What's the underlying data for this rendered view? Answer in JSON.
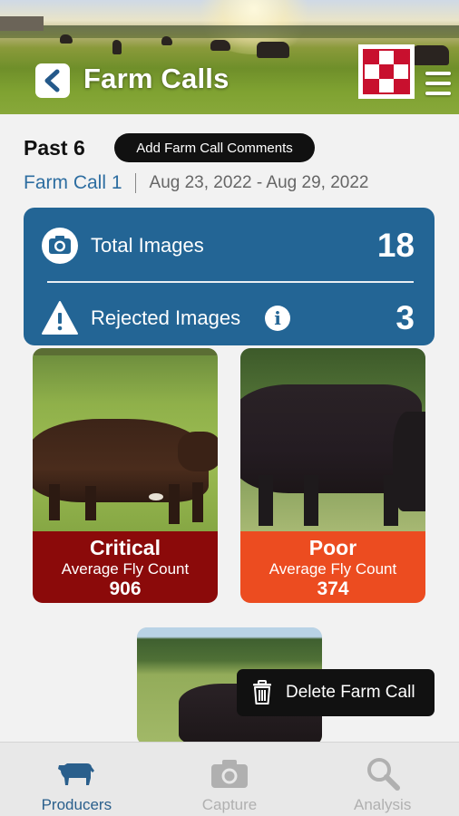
{
  "header": {
    "title": "Farm Calls",
    "back_icon": "chevron-left-icon",
    "logo_icon": "checkerboard-logo",
    "menu_icon": "hamburger-menu-icon"
  },
  "summary": {
    "past_label": "Past 6",
    "comments_button": "Add Farm Call Comments",
    "farm_call_link": "Farm Call 1",
    "date_range": "Aug 23, 2022 - Aug 29, 2022"
  },
  "stats": {
    "total_label": "Total Images",
    "total_value": "18",
    "rejected_label": "Rejected Images",
    "rejected_value": "3",
    "color": "#236595"
  },
  "cards": [
    {
      "rating": "Critical",
      "metric_label": "Average Fly Count",
      "count": "906",
      "color": "#8b0a0a"
    },
    {
      "rating": "Poor",
      "metric_label": "Average Fly Count",
      "count": "374",
      "color": "#ec4c20"
    }
  ],
  "toast": {
    "label": "Delete Farm Call",
    "icon": "trash-icon"
  },
  "tabbar": {
    "items": [
      {
        "label": "Producers",
        "icon": "cow-icon",
        "active": true
      },
      {
        "label": "Capture",
        "icon": "camera-icon",
        "active": false
      },
      {
        "label": "Analysis",
        "icon": "magnifier-icon",
        "active": false
      }
    ],
    "active_color": "#2a5f8c",
    "inactive_color": "#b0b0b0"
  }
}
